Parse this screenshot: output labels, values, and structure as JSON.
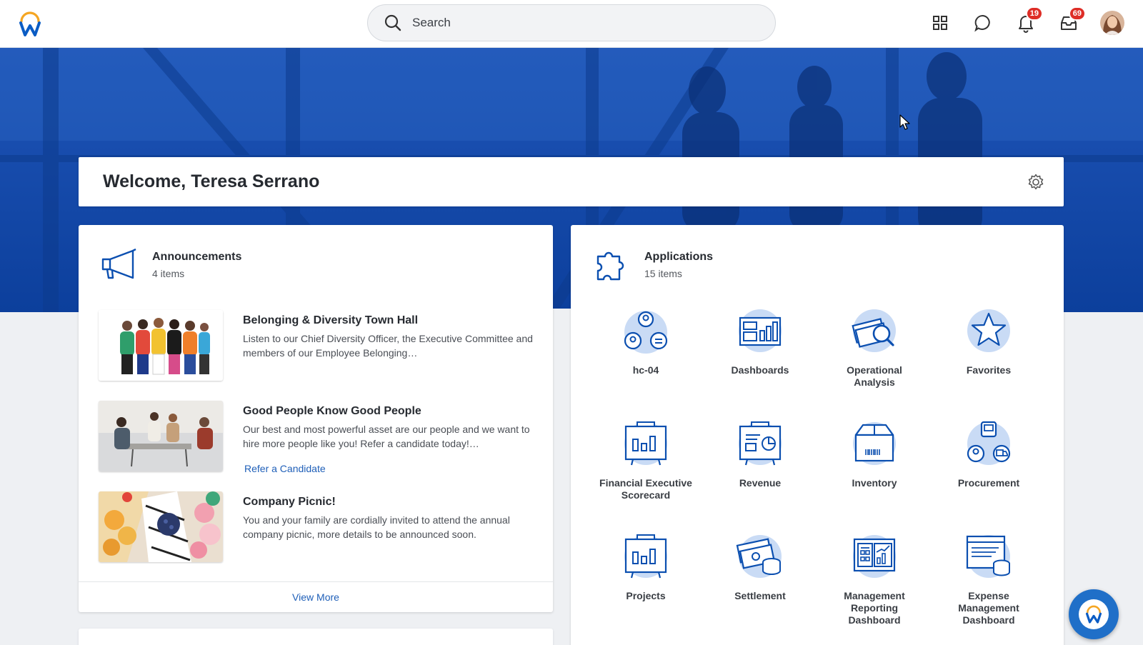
{
  "search": {
    "placeholder": "Search"
  },
  "header": {
    "notifications_count": "19",
    "inbox_count": "69"
  },
  "welcome": {
    "title": "Welcome, Teresa Serrano"
  },
  "announcements": {
    "title": "Announcements",
    "count": "4 items",
    "items": [
      {
        "title": "Belonging & Diversity Town Hall",
        "desc": "Listen to our Chief Diversity Officer, the Executive Committee and members of our Employee Belonging…"
      },
      {
        "title": "Good People Know Good People",
        "desc": "Our best and most powerful asset are our people and we want to hire more people like you! Refer a candidate today!…",
        "link": "Refer a Candidate"
      },
      {
        "title": "Company Picnic!",
        "desc": "You and your family are cordially invited to attend the annual company picnic, more details to be announced soon."
      }
    ],
    "view_more": "View More"
  },
  "applications": {
    "title": "Applications",
    "count": "15 items",
    "items": [
      {
        "label": "hc-04",
        "icon": "people-group-icon"
      },
      {
        "label": "Dashboards",
        "icon": "dashboard-icon"
      },
      {
        "label": "Operational Analysis",
        "icon": "money-magnifier-icon"
      },
      {
        "label": "Favorites",
        "icon": "star-icon"
      },
      {
        "label": "Financial Executive Scorecard",
        "icon": "presentation-board-icon"
      },
      {
        "label": "Revenue",
        "icon": "revenue-board-icon"
      },
      {
        "label": "Inventory",
        "icon": "box-icon"
      },
      {
        "label": "Procurement",
        "icon": "procurement-icon"
      },
      {
        "label": "Projects",
        "icon": "presentation-board-icon"
      },
      {
        "label": "Settlement",
        "icon": "cash-coins-icon"
      },
      {
        "label": "Management Reporting Dashboard",
        "icon": "report-chart-icon"
      },
      {
        "label": "Expense Management Dashboard",
        "icon": "expense-icon"
      }
    ]
  },
  "colors": {
    "brand_blue": "#0b4fb0",
    "accent_orange": "#f5a623",
    "badge_red": "#de2d26",
    "link_blue": "#1f5fb8"
  }
}
